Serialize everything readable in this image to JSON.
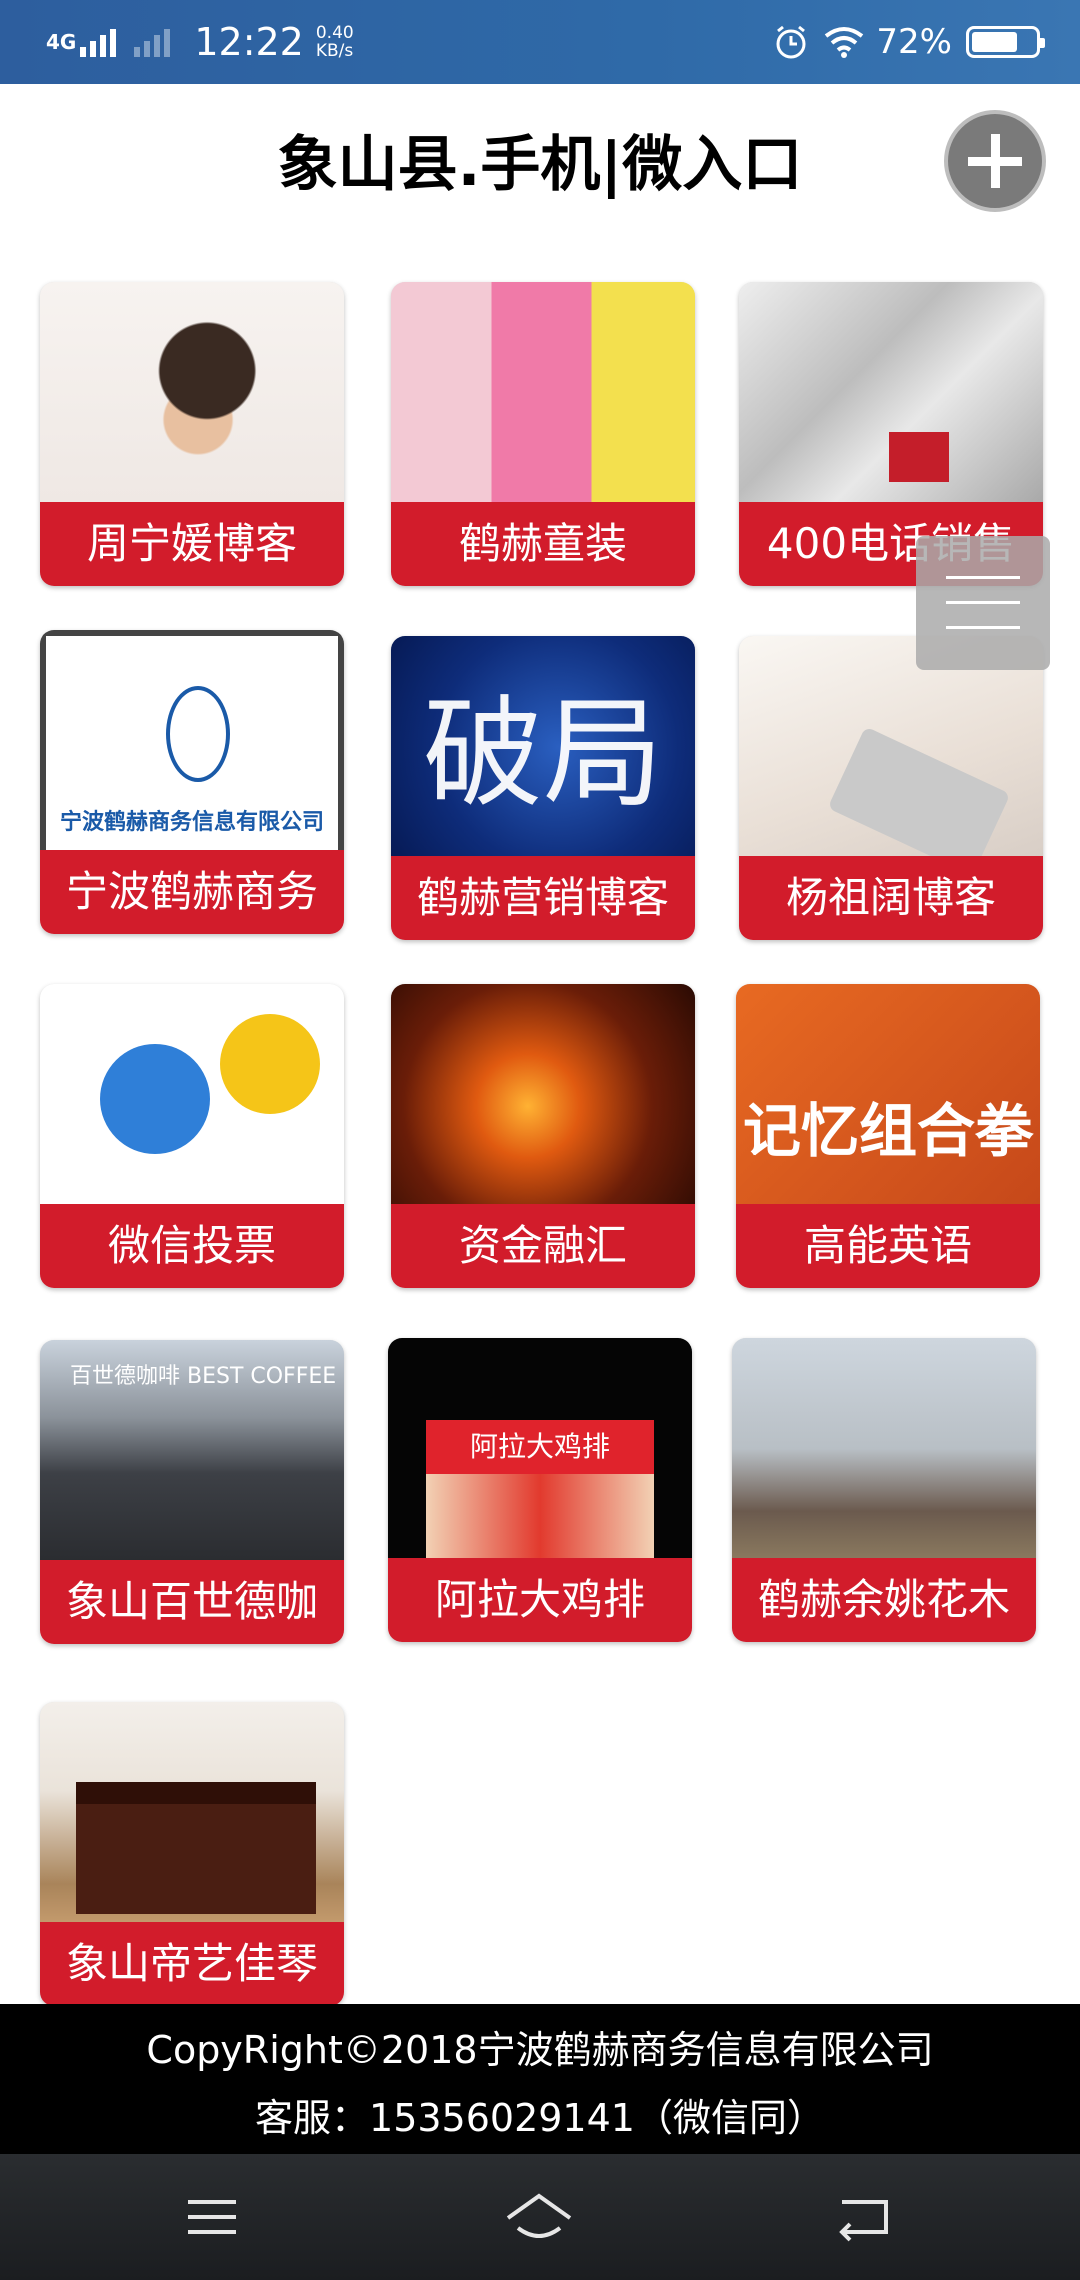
{
  "status_bar": {
    "network": "4G",
    "time": "12:22",
    "speed_value": "0.40",
    "speed_unit": "KB/s",
    "battery": "72%",
    "battery_level": 0.72,
    "icons": [
      "alarm-icon",
      "wifi-icon",
      "battery-icon"
    ]
  },
  "header": {
    "title": "象山县.手机|微入口",
    "add_icon": "plus-icon"
  },
  "tiles": [
    {
      "label": "周宁媛博客"
    },
    {
      "label": "鹤赫童装"
    },
    {
      "label": "400电话销售"
    },
    {
      "label": "宁波鹤赫商务",
      "image_text": "宁波鹤赫商务信息有限公司"
    },
    {
      "label": "鹤赫营销博客",
      "image_text": "破局"
    },
    {
      "label": "杨祖阔博客"
    },
    {
      "label": "微信投票"
    },
    {
      "label": "资金融汇"
    },
    {
      "label": "高能英语",
      "image_text": "记忆组合拳"
    },
    {
      "label": "象山百世德咖",
      "image_text": "百世德咖啡 BEST COFFEE"
    },
    {
      "label": "阿拉大鸡排",
      "image_text": "阿拉大鸡排"
    },
    {
      "label": "鹤赫余姚花木"
    },
    {
      "label": "象山帝艺佳琴"
    }
  ],
  "footer": {
    "copyright": "CopyRight©2018宁波鹤赫商务信息有限公司",
    "service": "客服：15356029141（微信同）"
  },
  "nav": {
    "icons": [
      "menu-icon",
      "home-icon",
      "back-icon"
    ]
  },
  "colors": {
    "status_bar": "#2f6aa8",
    "tile_label": "#d21c2b",
    "footer": "#000000",
    "navbar": "#1b1d20"
  }
}
